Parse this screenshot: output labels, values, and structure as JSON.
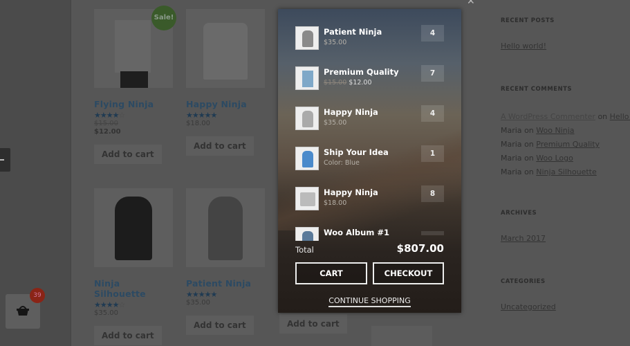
{
  "shop": {
    "sale_badge": "Sale!",
    "products": [
      {
        "name": "Flying Ninja",
        "rating": 4,
        "old_price": "$15.00",
        "price": "$12.00",
        "button": "Add to cart"
      },
      {
        "name": "Happy Ninja",
        "rating": 5,
        "price": "$18.00",
        "button": "Add to cart"
      },
      {
        "name": "Ninja Silhouette",
        "rating": 4,
        "price": "$35.00",
        "button": "Add to cart"
      },
      {
        "name": "Patient Ninja",
        "rating": 5,
        "price": "$35.00",
        "button": "Add to cart"
      }
    ],
    "partial_button": "Add to cart"
  },
  "sidebar": {
    "recent_posts_title": "RECENT POSTS",
    "recent_posts": [
      "Hello world!"
    ],
    "recent_comments_title": "RECENT COMMENTS",
    "comments": [
      {
        "author": "A WordPress Commenter",
        "on": "on",
        "post": "Hello wo"
      },
      {
        "author": "Maria",
        "on": "on",
        "post": "Woo Ninja"
      },
      {
        "author": "Maria",
        "on": "on",
        "post": "Premium Quality"
      },
      {
        "author": "Maria",
        "on": "on",
        "post": "Woo Logo"
      },
      {
        "author": "Maria",
        "on": "on",
        "post": "Ninja Silhouette"
      }
    ],
    "archives_title": "ARCHIVES",
    "archives": [
      "March 2017"
    ],
    "categories_title": "CATEGORIES",
    "categories": [
      "Uncategorized"
    ]
  },
  "cart_count": "39",
  "cart": {
    "close_icon": "close-icon",
    "items": [
      {
        "name": "Patient Ninja",
        "price": "$35.00",
        "qty": "4"
      },
      {
        "name": "Premium Quality",
        "old_price": "$15.00",
        "price": "$12.00",
        "qty": "7"
      },
      {
        "name": "Happy Ninja",
        "price": "$35.00",
        "qty": "4"
      },
      {
        "name": "Ship Your Idea",
        "variant": "Color: Blue",
        "qty": "1"
      },
      {
        "name": "Happy Ninja",
        "price": "$18.00",
        "qty": "8"
      },
      {
        "name": "Woo Album #1"
      }
    ],
    "total_label": "Total",
    "total_value": "$807.00",
    "cart_button": "CART",
    "checkout_button": "CHECKOUT",
    "continue_link": "CONTINUE SHOPPING"
  }
}
